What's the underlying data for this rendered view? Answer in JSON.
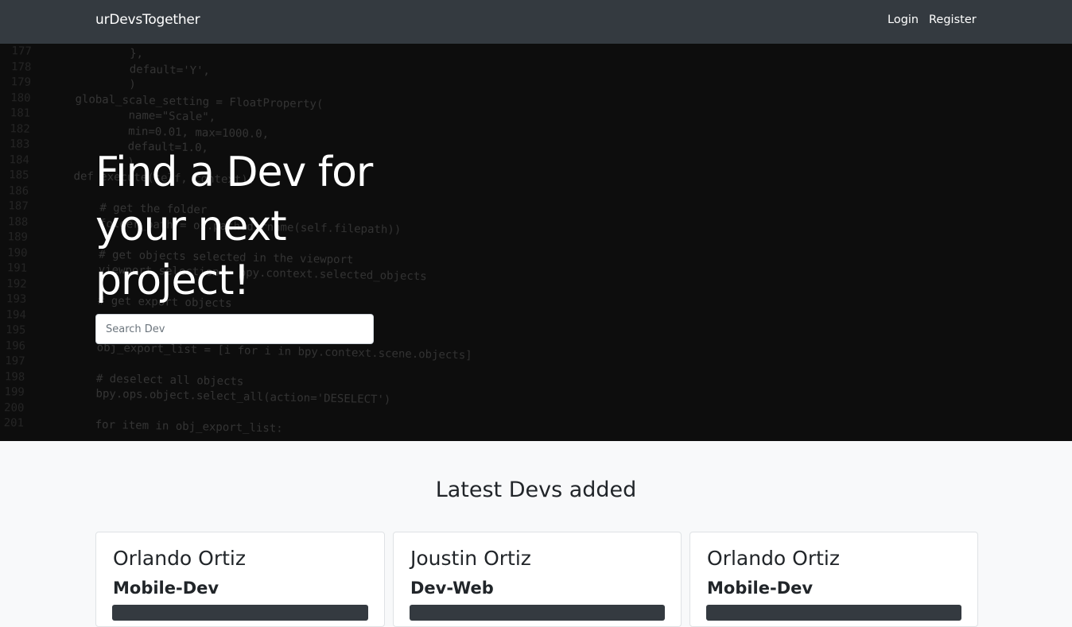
{
  "navbar": {
    "brand": "urDevsTogether",
    "login": "Login",
    "register": "Register"
  },
  "hero": {
    "title": "Find a Dev for your next project!",
    "search_placeholder": "Search Dev"
  },
  "code_background": [
    {
      "n": "177",
      "t": "        },"
    },
    {
      "n": "178",
      "t": "        default='Y',"
    },
    {
      "n": "179",
      "t": "        )"
    },
    {
      "n": "180",
      "t": "global_scale_setting = FloatProperty("
    },
    {
      "n": "181",
      "t": "        name=\"Scale\","
    },
    {
      "n": "182",
      "t": "        min=0.01, max=1000.0,"
    },
    {
      "n": "183",
      "t": "        default=1.0,"
    },
    {
      "n": "184",
      "t": "        )"
    },
    {
      "n": "185",
      "t": "def execute(self, context):"
    },
    {
      "n": "186",
      "t": ""
    },
    {
      "n": "187",
      "t": "    # get the folder"
    },
    {
      "n": "188",
      "t": "    folder_path = os.path.dirname(self.filepath))"
    },
    {
      "n": "189",
      "t": ""
    },
    {
      "n": "190",
      "t": "    # get objects selected in the viewport"
    },
    {
      "n": "191",
      "t": "    viewport_selection = bpy.context.selected_objects"
    },
    {
      "n": "192",
      "t": ""
    },
    {
      "n": "193",
      "t": "    # get export objects"
    },
    {
      "n": "194",
      "t": ""
    },
    {
      "n": "195",
      "t": ""
    },
    {
      "n": "196",
      "t": "    obj_export_list = [i for i in bpy.context.scene.objects]"
    },
    {
      "n": "197",
      "t": ""
    },
    {
      "n": "198",
      "t": "    # deselect all objects"
    },
    {
      "n": "199",
      "t": "    bpy.ops.object.select_all(action='DESELECT')"
    },
    {
      "n": "200",
      "t": ""
    },
    {
      "n": "201",
      "t": "    for item in obj_export_list:"
    }
  ],
  "latest": {
    "title": "Latest Devs added",
    "devs": [
      {
        "name": "Orlando Ortiz",
        "role": "Mobile-Dev"
      },
      {
        "name": "Joustin Ortiz",
        "role": "Dev-Web"
      },
      {
        "name": "Orlando Ortiz",
        "role": "Mobile-Dev"
      }
    ]
  }
}
